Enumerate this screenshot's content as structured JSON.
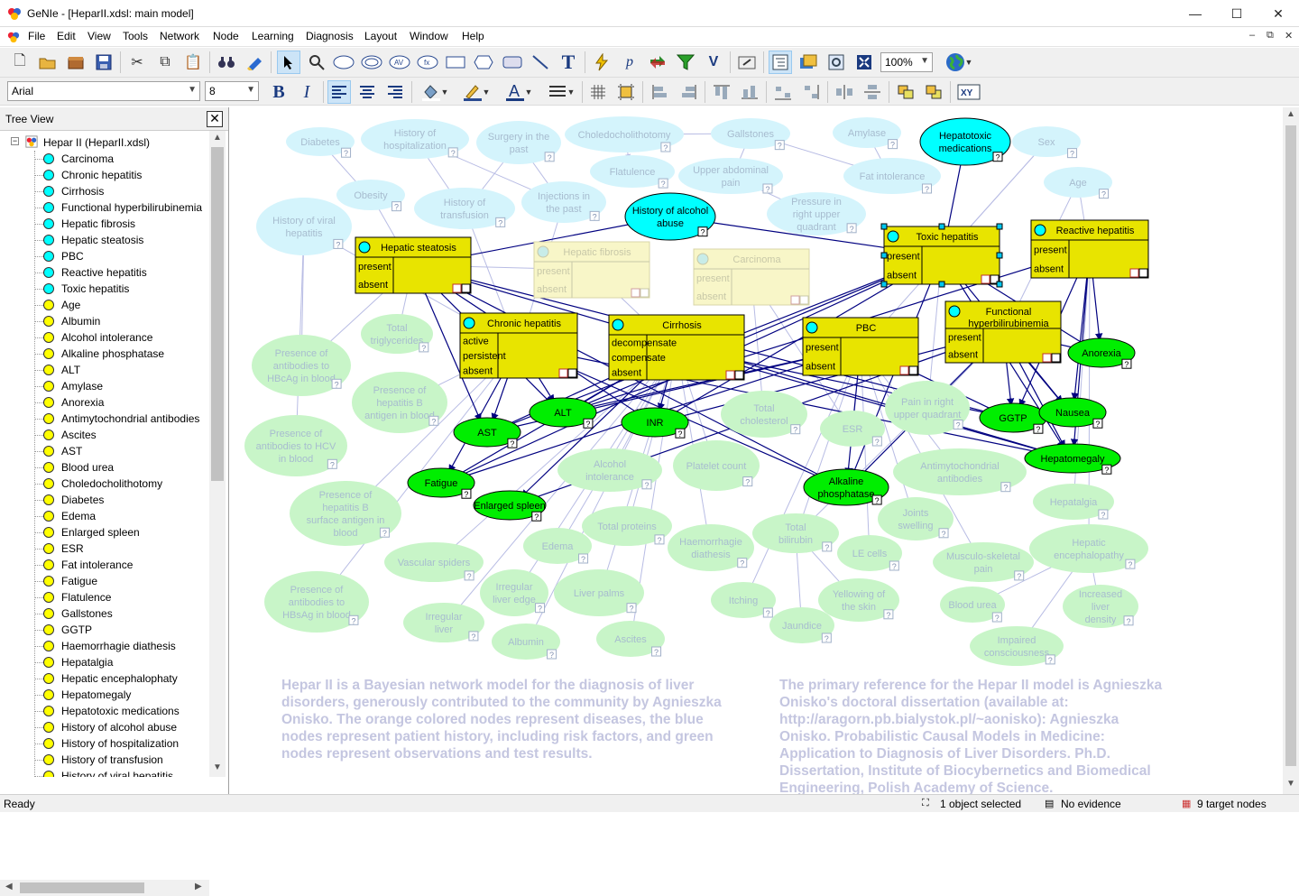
{
  "window": {
    "title": "GeNIe - [HeparII.xdsl: main model]",
    "minimize": "—",
    "maximize": "☐",
    "close": "✕"
  },
  "menu": [
    "File",
    "Edit",
    "View",
    "Tools",
    "Network",
    "Node",
    "Learning",
    "Diagnosis",
    "Layout",
    "Window",
    "Help"
  ],
  "toolbar": {
    "zoom": "100%",
    "font": "Arial",
    "font_size": "8"
  },
  "tree": {
    "title": "Tree View",
    "root": "Hepar II (HeparII.xdsl)",
    "items": [
      {
        "label": "Carcinoma",
        "color": "#00ffff"
      },
      {
        "label": "Chronic hepatitis",
        "color": "#00ffff"
      },
      {
        "label": "Cirrhosis",
        "color": "#00ffff"
      },
      {
        "label": "Functional hyperbilirubinemia",
        "color": "#00ffff"
      },
      {
        "label": "Hepatic fibrosis",
        "color": "#00ffff"
      },
      {
        "label": "Hepatic steatosis",
        "color": "#00ffff"
      },
      {
        "label": "PBC",
        "color": "#00ffff"
      },
      {
        "label": "Reactive hepatitis",
        "color": "#00ffff"
      },
      {
        "label": "Toxic hepatitis",
        "color": "#00ffff"
      },
      {
        "label": "Age",
        "color": "#ffff00"
      },
      {
        "label": "Albumin",
        "color": "#ffff00"
      },
      {
        "label": "Alcohol intolerance",
        "color": "#ffff00"
      },
      {
        "label": "Alkaline phosphatase",
        "color": "#ffff00"
      },
      {
        "label": "ALT",
        "color": "#ffff00"
      },
      {
        "label": "Amylase",
        "color": "#ffff00"
      },
      {
        "label": "Anorexia",
        "color": "#ffff00"
      },
      {
        "label": "Antimytochondrial antibodies",
        "color": "#ffff00"
      },
      {
        "label": "Ascites",
        "color": "#ffff00"
      },
      {
        "label": "AST",
        "color": "#ffff00"
      },
      {
        "label": "Blood urea",
        "color": "#ffff00"
      },
      {
        "label": "Choledocholithotomy",
        "color": "#ffff00"
      },
      {
        "label": "Diabetes",
        "color": "#ffff00"
      },
      {
        "label": "Edema",
        "color": "#ffff00"
      },
      {
        "label": "Enlarged spleen",
        "color": "#ffff00"
      },
      {
        "label": "ESR",
        "color": "#ffff00"
      },
      {
        "label": "Fat intolerance",
        "color": "#ffff00"
      },
      {
        "label": "Fatigue",
        "color": "#ffff00"
      },
      {
        "label": "Flatulence",
        "color": "#ffff00"
      },
      {
        "label": "Gallstones",
        "color": "#ffff00"
      },
      {
        "label": "GGTP",
        "color": "#ffff00"
      },
      {
        "label": "Haemorrhagie diathesis",
        "color": "#ffff00"
      },
      {
        "label": "Hepatalgia",
        "color": "#ffff00"
      },
      {
        "label": "Hepatic encephalophaty",
        "color": "#ffff00"
      },
      {
        "label": "Hepatomegaly",
        "color": "#ffff00"
      },
      {
        "label": "Hepatotoxic medications",
        "color": "#ffff00"
      },
      {
        "label": "History of alcohol abuse",
        "color": "#ffff00"
      },
      {
        "label": "History of hospitalization",
        "color": "#ffff00"
      },
      {
        "label": "History of transfusion",
        "color": "#ffff00"
      },
      {
        "label": "History of viral hepatitis",
        "color": "#ffff00"
      }
    ]
  },
  "description_left": "Hepar II is a Bayesian network model for the diagnosis of liver disorders, generously contributed to the community by Agnieszka Onisko. The orange colored nodes represent diseases, the blue nodes represent patient history, including risk factors, and green nodes represent observations and test results.",
  "description_right": "The primary reference for the Hepar II model is Agnieszka Onisko's doctoral dissertation (available at: http://aragorn.pb.bialystok.pl/~aonisko): Agnieszka Onisko. Probabilistic Causal Models in Medicine: Application to Diagnosis of Liver Disorders. Ph.D. Dissertation, Institute of Biocybernetics and Biomedical Engineering, Polish Academy of Science.",
  "status": {
    "ready": "Ready",
    "selected": "1 object selected",
    "evidence": "No evidence",
    "targets": "9 target nodes"
  },
  "faded_blue_nodes": [
    "Diabetes",
    "History of hospitalization",
    "Surgery in the past",
    "Choledocholithotomy",
    "Gallstones",
    "Amylase",
    "Sex",
    "Obesity",
    "History of transfusion",
    "Injections in the past",
    "Flatulence",
    "Upper abdominal pain",
    "Fat intolerance",
    "Age",
    "History of viral hepatitis",
    "Pressure in right upper quadrant"
  ],
  "faded_green_nodes": [
    "Total triglycerides",
    "Presence of antibodies to HBcAg in blood",
    "Presence of hepatitis B antigen in blood",
    "Presence of antibodies to HCV in blood",
    "Total cholesterol",
    "ESR",
    "Pain in right upper quadrant",
    "Alcohol intolerance",
    "Platelet count",
    "Antimytochondrial antibodies",
    "Presence of hepatitis B surface antigen in blood",
    "Total proteins",
    "Haemorrhagie diathesis",
    "Total bilirubin",
    "Joints swelling",
    "Hepatalgia",
    "Hepatic encephalopathy",
    "Vascular spiders",
    "Edema",
    "Irregular liver edge",
    "Liver palms",
    "LE cells",
    "Musculo-skeletal pain",
    "Presence of antibodies to HBsAg in blood",
    "Irregular liver",
    "Itching",
    "Yellowing of the skin",
    "Blood urea",
    "Increased liver density",
    "Albumin",
    "Ascites",
    "Jaundice",
    "Impaired consciousness"
  ],
  "active_blue_nodes": [
    "History of alcohol abuse",
    "Hepatotoxic medications"
  ],
  "active_green_nodes": [
    "AST",
    "ALT",
    "INR",
    "Fatigue",
    "Enlarged spleen",
    "Alkaline phosphatase",
    "GGTP",
    "Nausea",
    "Anorexia",
    "Hepatomegaly"
  ],
  "diseases": [
    {
      "name": "Hepatic steatosis",
      "states": [
        "present",
        "absent"
      ],
      "faded": false
    },
    {
      "name": "Hepatic fibrosis",
      "states": [
        "present",
        "absent"
      ],
      "faded": true
    },
    {
      "name": "Carcinoma",
      "states": [
        "present",
        "absent"
      ],
      "faded": true
    },
    {
      "name": "Toxic hepatitis",
      "states": [
        "present",
        "absent"
      ],
      "faded": false
    },
    {
      "name": "Reactive hepatitis",
      "states": [
        "present",
        "absent"
      ],
      "faded": false
    },
    {
      "name": "Chronic hepatitis",
      "states": [
        "active",
        "persistent",
        "absent"
      ],
      "faded": false
    },
    {
      "name": "Cirrhosis",
      "states": [
        "decompensate",
        "compensate",
        "absent"
      ],
      "faded": false
    },
    {
      "name": "PBC",
      "states": [
        "present",
        "absent"
      ],
      "faded": false
    },
    {
      "name": "Functional hyperbilirubinemia",
      "states": [
        "present",
        "absent"
      ],
      "faded": false
    }
  ],
  "colors": {
    "faded_blue": "#d4f4fc",
    "active_blue": "#00ffff",
    "faded_green": "#c8f5c8",
    "active_green": "#00ee00",
    "disease": "#e8e400",
    "faded_disease": "#f8f6c8",
    "arc_dark": "#000080",
    "arc_faded": "#b8bce4"
  }
}
